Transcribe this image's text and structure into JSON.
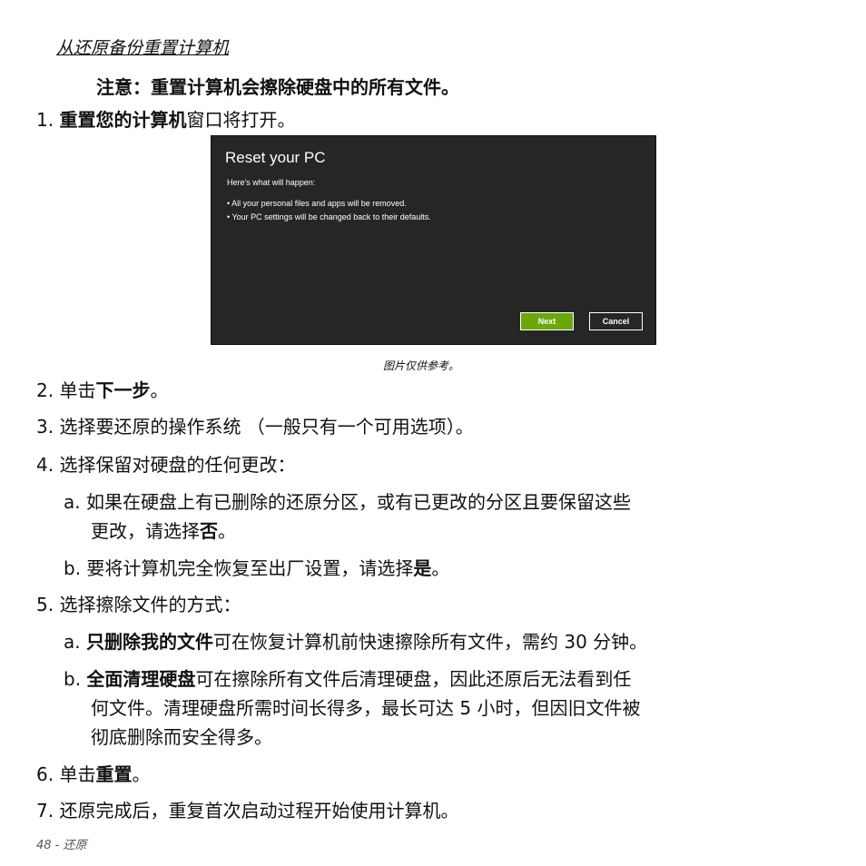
{
  "section_title": "从还原备份重置计算机",
  "note": "注意：重置计算机会擦除硬盘中的所有文件。",
  "step1": {
    "num": "1. ",
    "bold": "重置您的计算机",
    "rest": "窗口将打开。"
  },
  "dialog": {
    "title": "Reset your PC",
    "subtitle": "Here's what will happen:",
    "bullets": [
      "• All your personal files and apps will be removed.",
      "• Your PC settings will be changed back to their defaults."
    ],
    "next_label": "Next",
    "cancel_label": "Cancel",
    "accent": "#6aa80a",
    "background": "#262626"
  },
  "caption": "图片仅供参考。",
  "step2": {
    "num": "2. ",
    "pre": "单击",
    "bold": "下一步",
    "post": "。"
  },
  "step3": "3. 选择要还原的操作系统 （一般只有一个可用选项）。",
  "step4": "4. 选择保留对硬盘的任何更改：",
  "step4a": {
    "num": "a. ",
    "line1": "如果在硬盘上有已删除的还原分区，或有已更改的分区且要保留这些",
    "line2_pre": "更改，请选择",
    "line2_bold": "否",
    "line2_post": "。"
  },
  "step4b": {
    "num": "b. ",
    "pre": "要将计算机完全恢复至出厂设置，请选择",
    "bold": "是",
    "post": "。"
  },
  "step5": "5. 选择擦除文件的方式：",
  "step5a": {
    "num": "a. ",
    "bold": "只删除我的文件",
    "rest": "可在恢复计算机前快速擦除所有文件，需约 30 分钟。"
  },
  "step5b": {
    "num": "b. ",
    "bold": "全面清理硬盘",
    "line1_rest": "可在擦除所有文件后清理硬盘，因此还原后无法看到任",
    "line2": "何文件。清理硬盘所需时间长得多，最长可达 5 小时，但因旧文件被",
    "line3": "彻底删除而安全得多。"
  },
  "step6": {
    "num": "6. ",
    "pre": "单击",
    "bold": "重置",
    "post": "。"
  },
  "step7": "7. 还原完成后，重复首次启动过程开始使用计算机。",
  "footer": "48 - 还原"
}
